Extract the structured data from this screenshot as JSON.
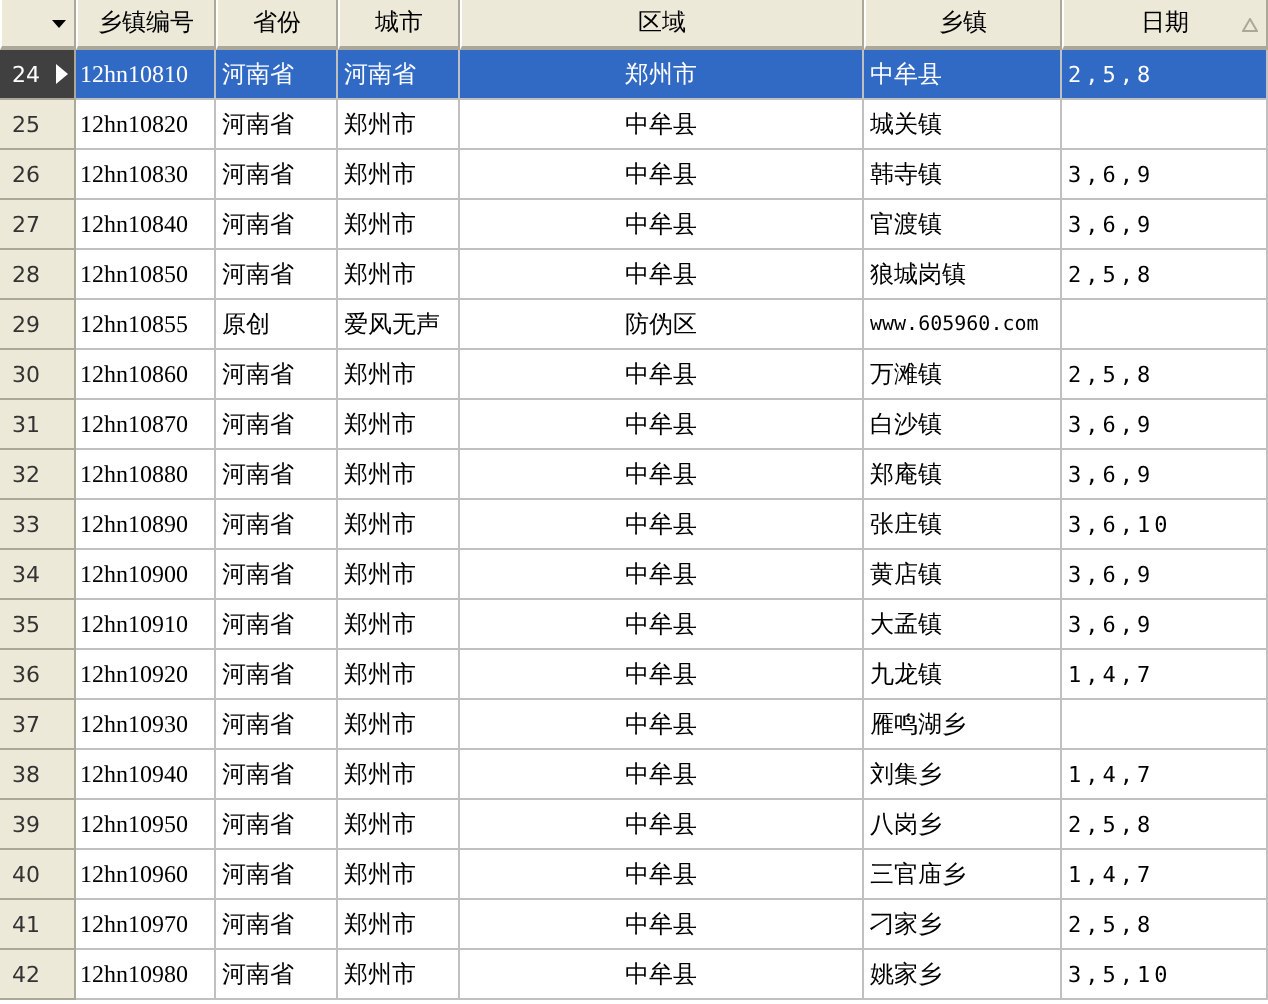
{
  "table": {
    "columns": [
      {
        "label": "乡镇编号",
        "sorted": false
      },
      {
        "label": "省份",
        "sorted": false
      },
      {
        "label": "城市",
        "sorted": false
      },
      {
        "label": "区域",
        "sorted": false
      },
      {
        "label": "乡镇",
        "sorted": false
      },
      {
        "label": "日期",
        "sorted": true
      }
    ],
    "rows": [
      {
        "number": "24",
        "selected": true,
        "cells": [
          "12hn10810",
          "河南省",
          "河南省",
          "郑州市",
          "中牟县",
          "2,5,8"
        ]
      },
      {
        "number": "25",
        "selected": false,
        "cells": [
          "12hn10820",
          "河南省",
          "郑州市",
          "中牟县",
          "城关镇",
          ""
        ]
      },
      {
        "number": "26",
        "selected": false,
        "cells": [
          "12hn10830",
          "河南省",
          "郑州市",
          "中牟县",
          "韩寺镇",
          "3,6,9"
        ]
      },
      {
        "number": "27",
        "selected": false,
        "cells": [
          "12hn10840",
          "河南省",
          "郑州市",
          "中牟县",
          "官渡镇",
          "3,6,9"
        ]
      },
      {
        "number": "28",
        "selected": false,
        "cells": [
          "12hn10850",
          "河南省",
          "郑州市",
          "中牟县",
          "狼城岗镇",
          "2,5,8"
        ]
      },
      {
        "number": "29",
        "selected": false,
        "cells": [
          "12hn10855",
          "原创",
          "爱风无声",
          "防伪区",
          "www.605960.com",
          ""
        ]
      },
      {
        "number": "30",
        "selected": false,
        "cells": [
          "12hn10860",
          "河南省",
          "郑州市",
          "中牟县",
          "万滩镇",
          "2,5,8"
        ]
      },
      {
        "number": "31",
        "selected": false,
        "cells": [
          "12hn10870",
          "河南省",
          "郑州市",
          "中牟县",
          "白沙镇",
          "3,6,9"
        ]
      },
      {
        "number": "32",
        "selected": false,
        "cells": [
          "12hn10880",
          "河南省",
          "郑州市",
          "中牟县",
          "郑庵镇",
          "3,6,9"
        ]
      },
      {
        "number": "33",
        "selected": false,
        "cells": [
          "12hn10890",
          "河南省",
          "郑州市",
          "中牟县",
          "张庄镇",
          "3,6,10"
        ]
      },
      {
        "number": "34",
        "selected": false,
        "cells": [
          "12hn10900",
          "河南省",
          "郑州市",
          "中牟县",
          "黄店镇",
          "3,6,9"
        ]
      },
      {
        "number": "35",
        "selected": false,
        "cells": [
          "12hn10910",
          "河南省",
          "郑州市",
          "中牟县",
          "大孟镇",
          "3,6,9"
        ]
      },
      {
        "number": "36",
        "selected": false,
        "cells": [
          "12hn10920",
          "河南省",
          "郑州市",
          "中牟县",
          "九龙镇",
          "1,4,7"
        ]
      },
      {
        "number": "37",
        "selected": false,
        "cells": [
          "12hn10930",
          "河南省",
          "郑州市",
          "中牟县",
          "雁鸣湖乡",
          ""
        ]
      },
      {
        "number": "38",
        "selected": false,
        "cells": [
          "12hn10940",
          "河南省",
          "郑州市",
          "中牟县",
          "刘集乡",
          "1,4,7"
        ]
      },
      {
        "number": "39",
        "selected": false,
        "cells": [
          "12hn10950",
          "河南省",
          "郑州市",
          "中牟县",
          "八岗乡",
          "2,5,8"
        ]
      },
      {
        "number": "40",
        "selected": false,
        "cells": [
          "12hn10960",
          "河南省",
          "郑州市",
          "中牟县",
          "三官庙乡",
          "1,4,7"
        ]
      },
      {
        "number": "41",
        "selected": false,
        "cells": [
          "12hn10970",
          "河南省",
          "郑州市",
          "中牟县",
          "刁家乡",
          "2,5,8"
        ]
      },
      {
        "number": "42",
        "selected": false,
        "cells": [
          "12hn10980",
          "河南省",
          "郑州市",
          "中牟县",
          "姚家乡",
          "3,5,10"
        ]
      }
    ]
  }
}
